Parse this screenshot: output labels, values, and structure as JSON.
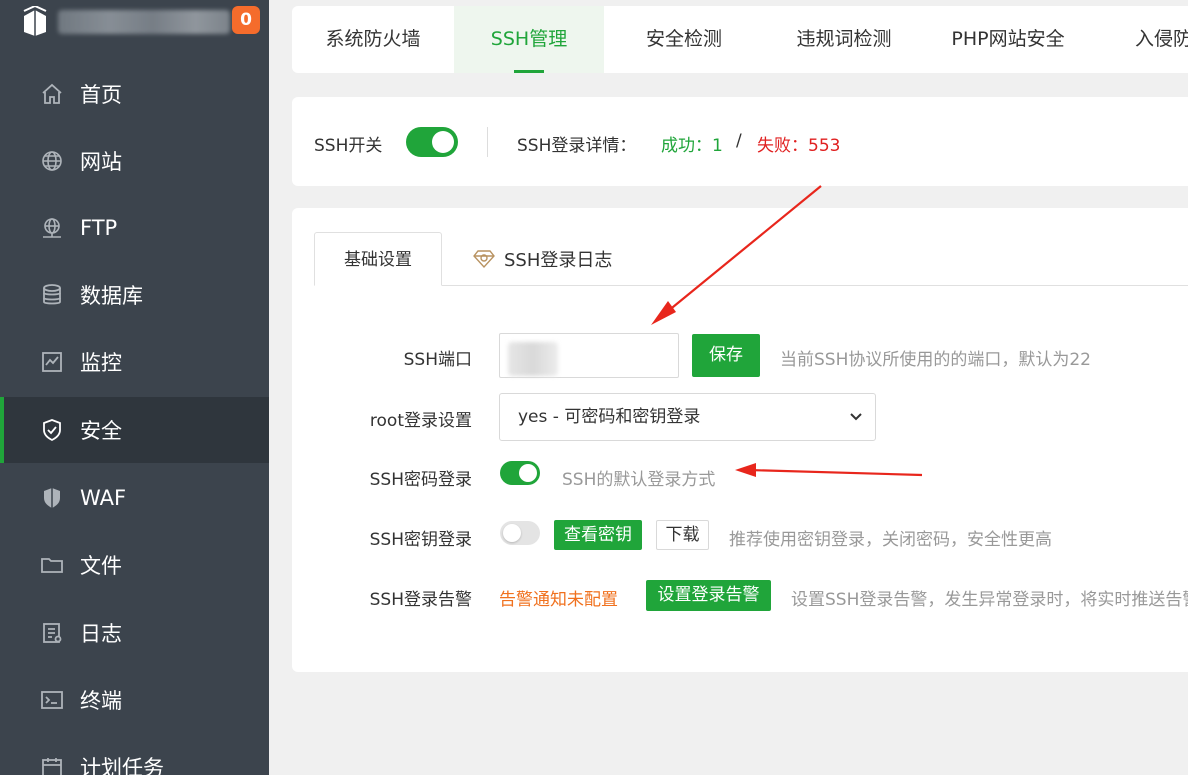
{
  "sidebar": {
    "badge": "0",
    "items": [
      {
        "label": "首页",
        "icon": "home-icon"
      },
      {
        "label": "网站",
        "icon": "globe-icon"
      },
      {
        "label": "FTP",
        "icon": "ftp-icon"
      },
      {
        "label": "数据库",
        "icon": "database-icon"
      },
      {
        "label": "监控",
        "icon": "monitor-icon"
      },
      {
        "label": "安全",
        "icon": "shield-icon",
        "active": true
      },
      {
        "label": "WAF",
        "icon": "waf-shield-icon"
      },
      {
        "label": "文件",
        "icon": "folder-icon"
      },
      {
        "label": "日志",
        "icon": "log-icon"
      },
      {
        "label": "终端",
        "icon": "terminal-icon"
      },
      {
        "label": "计划任务",
        "icon": "calendar-icon"
      }
    ]
  },
  "tabs": [
    {
      "label": "系统防火墙"
    },
    {
      "label": "SSH管理",
      "active": true
    },
    {
      "label": "安全检测"
    },
    {
      "label": "违规词检测"
    },
    {
      "label": "PHP网站安全"
    },
    {
      "label": "入侵防御"
    }
  ],
  "ssh_status": {
    "switch_label": "SSH开关",
    "switch_on": true,
    "detail_label": "SSH登录详情：",
    "success_label": "成功：",
    "success_count": "1",
    "separator": "/",
    "fail_label": "失败：",
    "fail_count": "553"
  },
  "subtabs": [
    {
      "label": "基础设置",
      "active": true
    },
    {
      "label": "SSH登录日志",
      "icon": "diamond-icon"
    }
  ],
  "form": {
    "port_label": "SSH端口",
    "port_value": "",
    "save_label": "保存",
    "port_hint": "当前SSH协议所使用的的端口，默认为22",
    "root_label": "root登录设置",
    "root_value": "yes - 可密码和密钥登录",
    "password_login_label": "SSH密码登录",
    "password_login_on": true,
    "password_login_hint": "SSH的默认登录方式",
    "key_login_label": "SSH密钥登录",
    "key_login_on": false,
    "view_key_label": "查看密钥",
    "download_label": "下载",
    "key_login_hint": "推荐使用密钥登录，关闭密码，安全性更高",
    "alert_label": "SSH登录告警",
    "alert_status": "告警通知未配置",
    "alert_button": "设置登录告警",
    "alert_hint": "设置SSH登录告警，发生异常登录时，将实时推送告警信息"
  },
  "colors": {
    "accent": "#20a53a",
    "sidebar_bg": "#3c444d",
    "fail": "#e02020",
    "warning": "#f0711e",
    "annotation_arrow": "#e8261c"
  }
}
